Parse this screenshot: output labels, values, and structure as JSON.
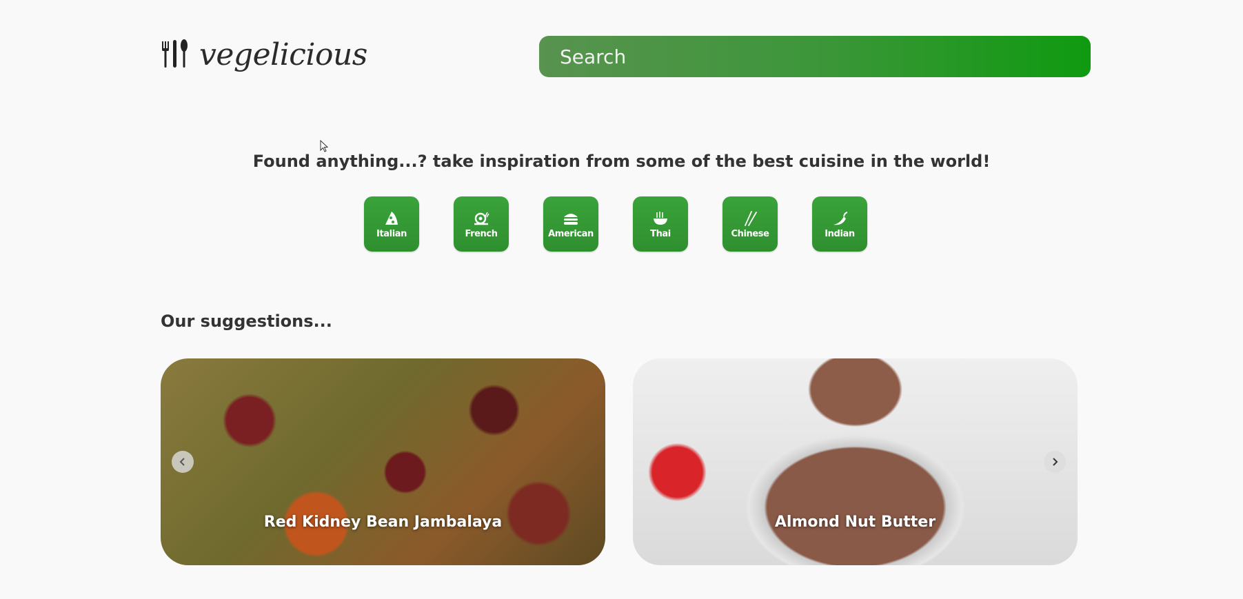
{
  "header": {
    "logo_text": "vegelicious",
    "search_placeholder": "Search"
  },
  "tagline": "Found anything...? take inspiration from some of the best cuisine in the world!",
  "cuisines": [
    {
      "label": "Italian",
      "icon": "pizza-icon"
    },
    {
      "label": "French",
      "icon": "snail-icon"
    },
    {
      "label": "American",
      "icon": "burger-icon"
    },
    {
      "label": "Thai",
      "icon": "noodle-bowl-icon"
    },
    {
      "label": "Chinese",
      "icon": "chopsticks-icon"
    },
    {
      "label": "Indian",
      "icon": "chili-icon"
    }
  ],
  "suggestions": {
    "title": "Our suggestions...",
    "cards": [
      {
        "title": "Red Kidney Bean Jambalaya"
      },
      {
        "title": "Almond Nut Butter"
      }
    ]
  },
  "colors": {
    "accent_start": "#58934f",
    "accent_end": "#0f9a10",
    "button_green": "#3aa33a",
    "background": "#f9f9f9"
  }
}
